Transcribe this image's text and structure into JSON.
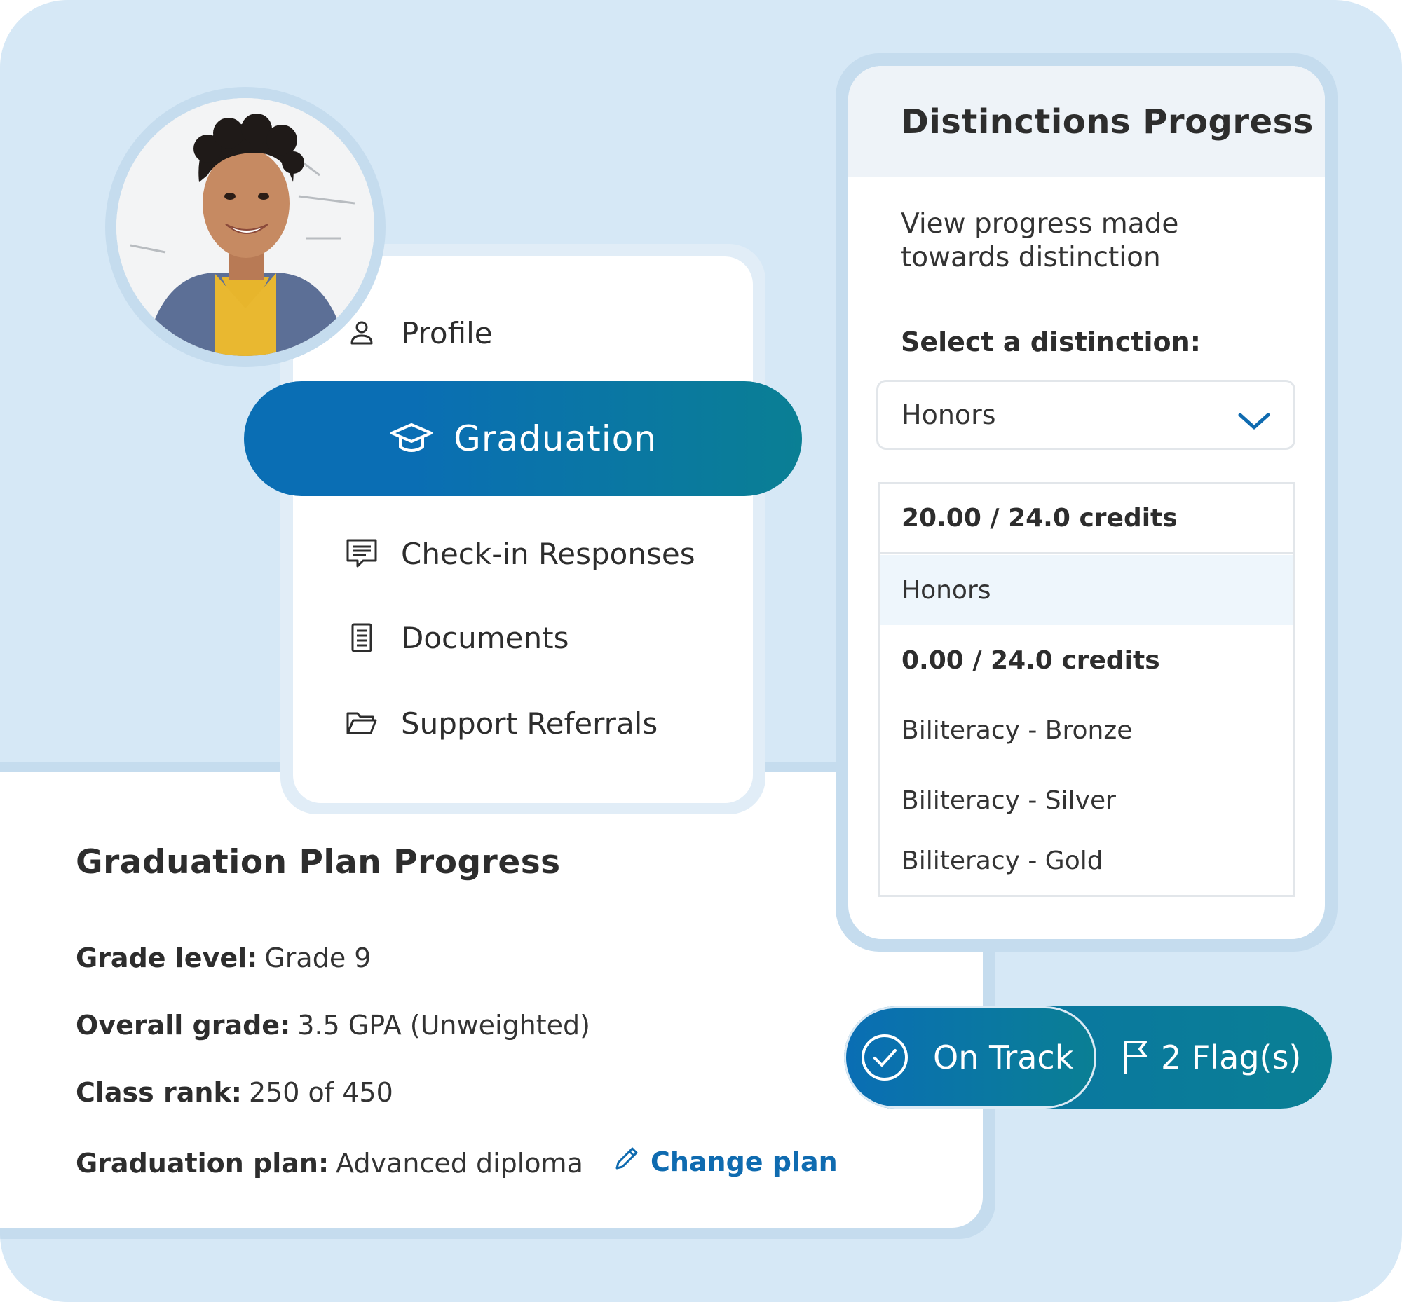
{
  "nav": {
    "items": [
      {
        "label": "Profile",
        "icon": "user-icon"
      },
      {
        "label": "Graduation",
        "icon": "graduation-cap-icon",
        "active": true
      },
      {
        "label": "Check-in Responses",
        "icon": "chat-icon"
      },
      {
        "label": "Documents",
        "icon": "document-icon"
      },
      {
        "label": "Support Referrals",
        "icon": "folder-icon"
      }
    ]
  },
  "distinctions": {
    "title": "Distinctions Progress",
    "description": "View progress made towards distinction",
    "select_label": "Select a distinction:",
    "selected_value": "Honors",
    "options": [
      {
        "label": "20.00 / 24.0 credits",
        "bold": true
      },
      {
        "label": "Honors",
        "highlighted": true
      },
      {
        "label": "0.00 / 24.0 credits",
        "bold": true
      },
      {
        "label": "Biliteracy - Bronze"
      },
      {
        "label": "Biliteracy - Silver"
      },
      {
        "label": "Biliteracy - Gold"
      }
    ]
  },
  "plan": {
    "title": "Graduation Plan Progress",
    "grade_level_label": "Grade level:",
    "grade_level": "Grade 9",
    "overall_grade_label": "Overall grade:",
    "overall_grade": "3.5 GPA (Unweighted)",
    "class_rank_label": "Class rank:",
    "class_rank": "250 of 450",
    "graduation_plan_label": "Graduation plan:",
    "graduation_plan": "Advanced diploma",
    "change_plan": "Change plan"
  },
  "status": {
    "on_track": "On Track",
    "flags": "2 Flag(s)"
  },
  "colors": {
    "background": "#d6e8f6",
    "primary": "#0a6eb4",
    "teal": "#0a7f94",
    "link": "#0f6bb0"
  }
}
